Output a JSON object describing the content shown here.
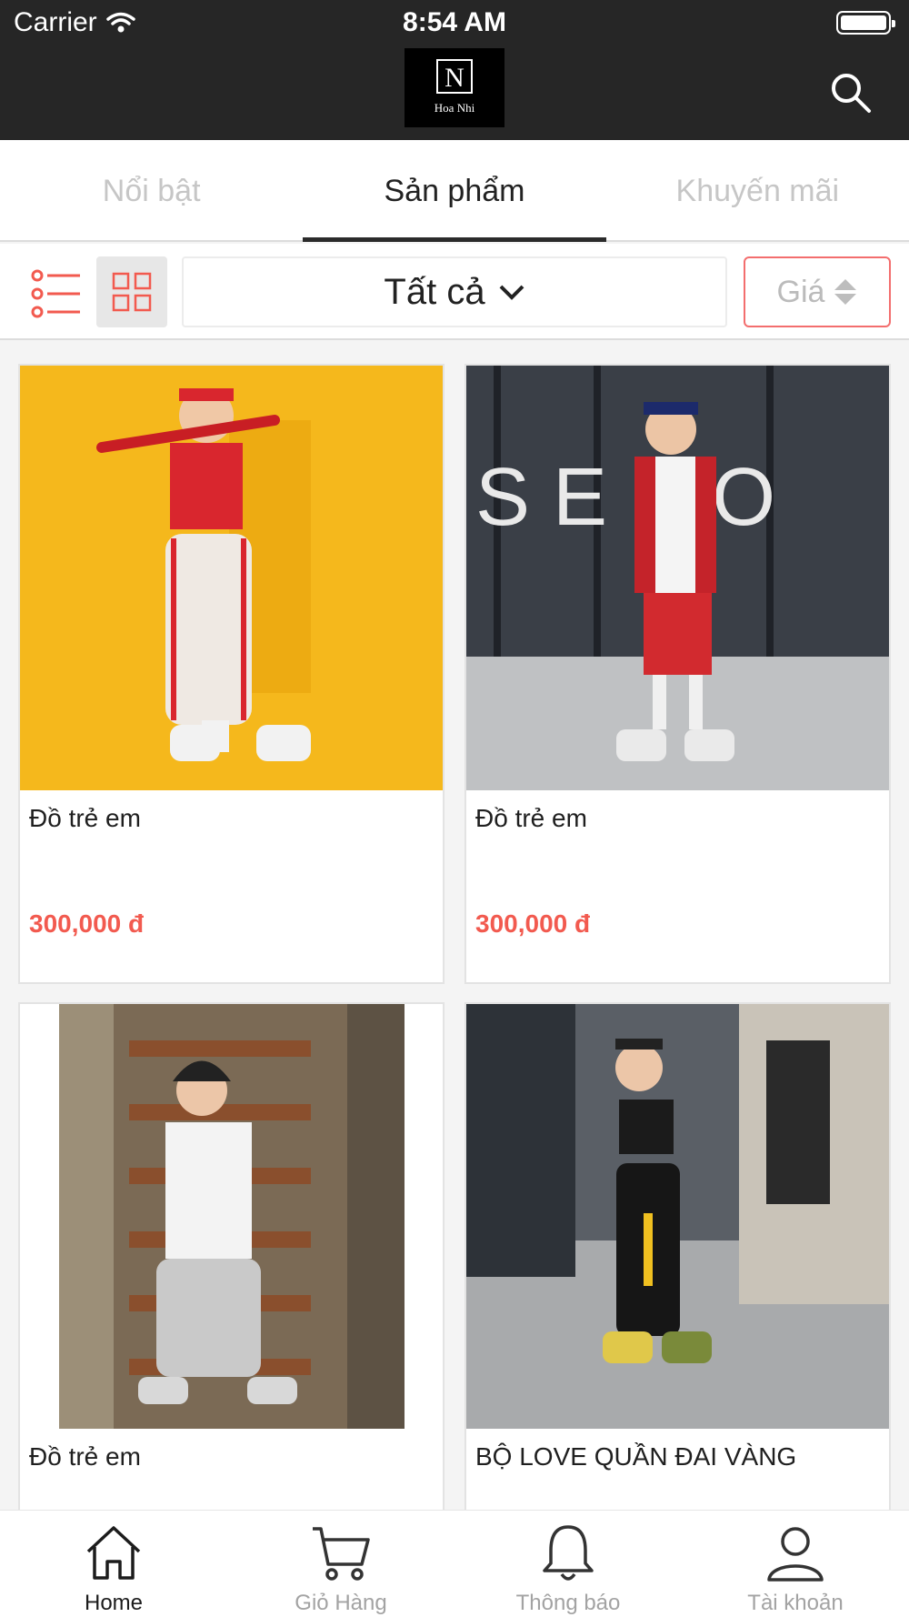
{
  "status_bar": {
    "carrier": "Carrier",
    "time": "8:54 AM"
  },
  "header": {
    "logo_letter": "N",
    "logo_name": "Hoa Nhi",
    "search_icon": "search-icon"
  },
  "tabs": [
    {
      "label": "Nổi bật",
      "active": false
    },
    {
      "label": "Sản phẩm",
      "active": true
    },
    {
      "label": "Khuyến mãi",
      "active": false
    }
  ],
  "filter": {
    "category_label": "Tất cả",
    "price_sort_label": "Giá"
  },
  "products": [
    {
      "name": "Đồ trẻ em",
      "price": "300,000 đ"
    },
    {
      "name": "Đồ trẻ em",
      "price": "300,000 đ"
    },
    {
      "name": "Đồ trẻ em",
      "price": ""
    },
    {
      "name": "BỘ LOVE QUẦN ĐAI VÀNG",
      "price": ""
    }
  ],
  "bottom_nav": [
    {
      "label": "Home",
      "icon": "home-icon",
      "active": true
    },
    {
      "label": "Giỏ Hàng",
      "icon": "cart-icon",
      "active": false
    },
    {
      "label": "Thông báo",
      "icon": "bell-icon",
      "active": false
    },
    {
      "label": "Tài khoản",
      "icon": "user-icon",
      "active": false
    }
  ],
  "colors": {
    "accent": "#f25a4f",
    "header_bg": "#262626",
    "active_tab": "#2b2b2b"
  }
}
